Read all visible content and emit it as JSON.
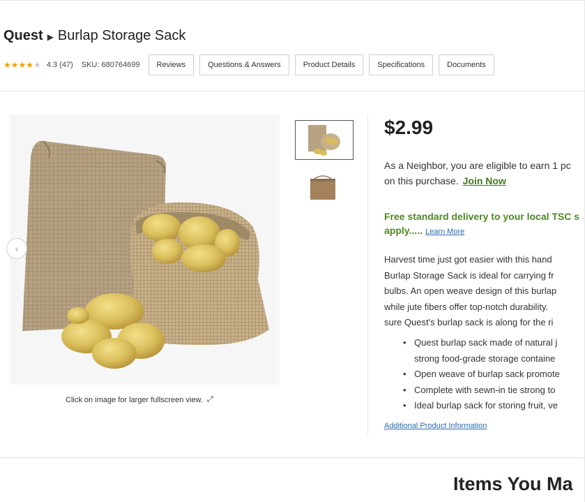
{
  "header": {
    "brand": "Quest",
    "product_name": "Burlap Storage Sack",
    "rating_value": 4.3,
    "rating_text": "4.3 (47)",
    "sku_text": "SKU: 680764699",
    "tabs": [
      {
        "label": "Reviews"
      },
      {
        "label": "Questions & Answers"
      },
      {
        "label": "Product Details"
      },
      {
        "label": "Specifications"
      },
      {
        "label": "Documents"
      }
    ]
  },
  "gallery": {
    "caption": "Click on image for larger fullscreen view.",
    "prev_icon": "chevron-left-icon",
    "fullscreen_icon": "expand-icon"
  },
  "purchase": {
    "price": "$2.99",
    "neighbor_text_1": "As a Neighbor, you are eligible to earn 1 pc",
    "neighbor_text_2": "on this purchase.",
    "join_link": "Join Now",
    "delivery_text_1": "Free standard delivery to your local TSC s",
    "delivery_text_2": "apply.....",
    "learn_more": "Learn More",
    "description_lines": [
      "Harvest time just got easier with this hand",
      "Burlap Storage Sack is ideal for carrying fr",
      "bulbs. An open weave design of this burlap",
      "while jute fibers offer top-notch durability.",
      "sure Quest's burlap sack is along for the ri"
    ],
    "bullets": [
      "Quest burlap sack made of natural j",
      "strong food-grade storage containe",
      "Open weave of burlap sack promote",
      "Complete with sewn-in tie strong to",
      "Ideal burlap sack for storing fruit, ve"
    ],
    "additional_info": "Additional Product Information"
  },
  "related": {
    "heading": "Items You Ma"
  },
  "colors": {
    "accent_green": "#4b8a1f",
    "link_blue": "#2a6bb3",
    "star_gold": "#f0a000"
  }
}
